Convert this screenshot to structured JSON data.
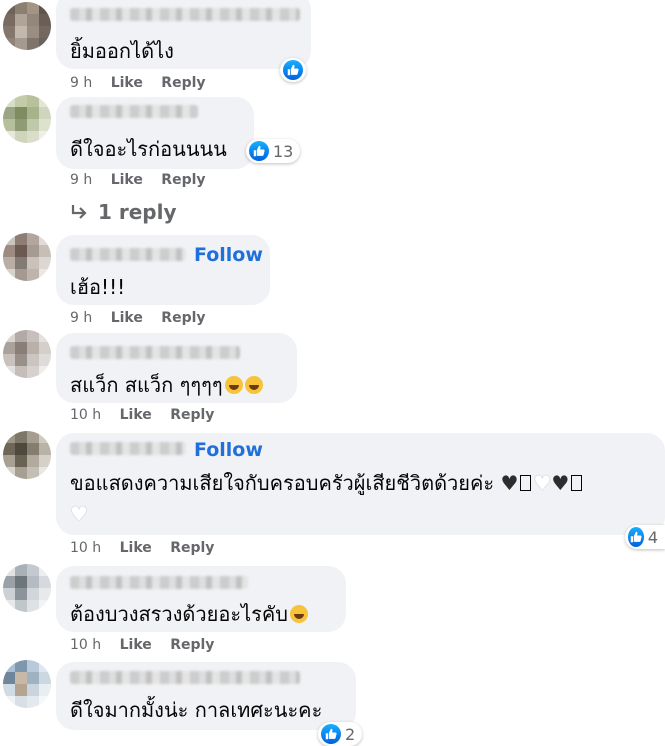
{
  "comments": [
    {
      "text": "ยิ้มออกได้ไง",
      "time": "9 h",
      "like": "Like",
      "reply": "Reply",
      "reaction_count": ""
    },
    {
      "text": "ดีใจอะไรก่อนนนน",
      "time": "9 h",
      "like": "Like",
      "reply": "Reply",
      "reaction_count": "13"
    },
    {
      "text": "เฮ้อ!!!",
      "time": "9 h",
      "like": "Like",
      "reply": "Reply",
      "follow": "Follow"
    },
    {
      "text": "สแว็ก สแว็ก ๆๆๆๆ",
      "time": "10 h",
      "like": "Like",
      "reply": "Reply"
    },
    {
      "text": "ขอแสดงความเสียใจกับครอบครัวผู้เสียชีวิตด้วยค่ะ",
      "time": "10 h",
      "like": "Like",
      "reply": "Reply",
      "follow": "Follow",
      "reaction_count": "4"
    },
    {
      "text": "ต้องบวงสรวงด้วยอะไรคับ",
      "time": "10 h",
      "like": "Like",
      "reply": "Reply"
    },
    {
      "text": "ดีใจมากมั้งน่ะ กาลเทศะนะคะ",
      "time": "",
      "like": "",
      "reply": "",
      "reaction_count": "2"
    }
  ],
  "view_replies": "1 reply",
  "colors": {
    "bubble": "#f0f2f5",
    "follow": "#216fdb",
    "meta": "#65676b",
    "like_blue": "#0866ff"
  },
  "icons": {
    "like": "thumbs-up-icon",
    "reply_arrow": "reply-arrow-icon",
    "laugh": "laughing-emoji-icon",
    "black_heart": "black-heart-icon",
    "white_heart": "white-heart-icon"
  }
}
